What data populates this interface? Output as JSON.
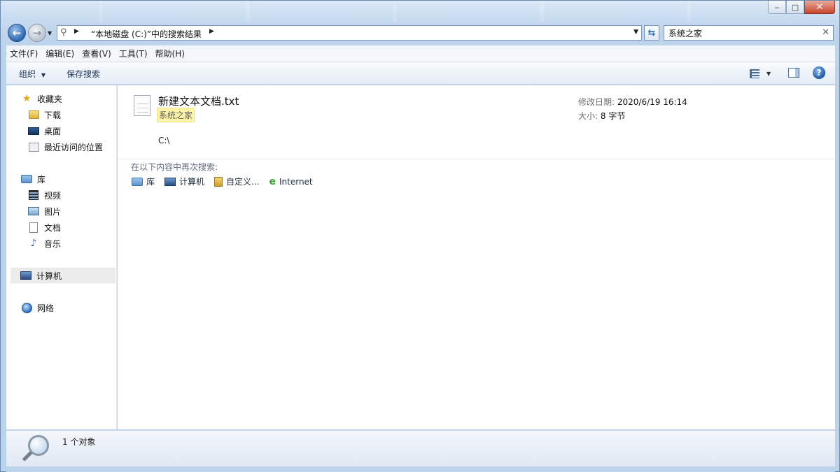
{
  "window": {
    "minimize_label": "‒",
    "maximize_label": "□",
    "close_label": "✕"
  },
  "address_bar": {
    "path": "“本地磁盘 (C:)”中的搜索结果"
  },
  "search": {
    "value": "系统之家"
  },
  "menu": [
    "文件(F)",
    "编辑(E)",
    "查看(V)",
    "工具(T)",
    "帮助(H)"
  ],
  "command_bar": {
    "organize_label": "组织",
    "save_search_label": "保存搜索",
    "help_label": "?"
  },
  "nav": {
    "favorites": "收藏夹",
    "downloads": "下载",
    "desktop": "桌面",
    "recent": "最近访问的位置",
    "libraries": "库",
    "videos": "视频",
    "pictures": "图片",
    "documents": "文档",
    "music": "音乐",
    "computer": "计算机",
    "network": "网络"
  },
  "result": {
    "file_name": "新建文本文档.txt",
    "tag": "系统之家",
    "path": "C:\\",
    "modified_label": "修改日期:",
    "modified_value": "2020/6/19 16:14",
    "size_label": "大小:",
    "size_value": "8 字节"
  },
  "search_again": {
    "label": "在以下内容中再次搜索:",
    "library": "库",
    "computer": "计算机",
    "custom": "自定义...",
    "internet": "Internet"
  },
  "status": {
    "count": "1 个对象"
  }
}
